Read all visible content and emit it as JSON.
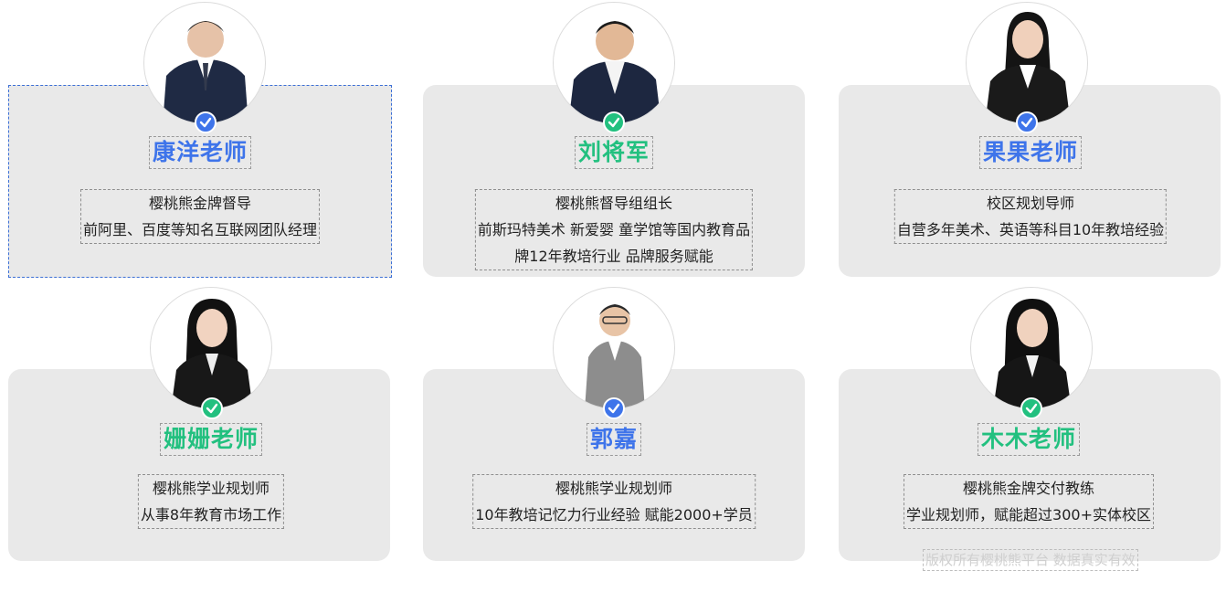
{
  "colors": {
    "blue_accent": "#3e74ea",
    "green_accent": "#22c07f",
    "card_bg": "#e9e9e9",
    "copyright_text": "#cfcfcf"
  },
  "teachers": [
    {
      "name": "康洋老师",
      "accent": "blue",
      "lines": [
        "樱桃熊金牌督导",
        "前阿里、百度等知名互联网团队经理"
      ],
      "icon": "check-badge-icon"
    },
    {
      "name": "刘将军",
      "accent": "green",
      "lines": [
        "樱桃熊督导组组长",
        "前斯玛特美术 新爱婴 童学馆等国内教育品",
        "牌12年教培行业 品牌服务赋能"
      ],
      "icon": "check-badge-icon"
    },
    {
      "name": "果果老师",
      "accent": "blue",
      "lines": [
        "校区规划导师",
        "自营多年美术、英语等科目10年教培经验"
      ],
      "icon": "check-badge-icon"
    },
    {
      "name": "姗姗老师",
      "accent": "green",
      "lines": [
        "樱桃熊学业规划师",
        "从事8年教育市场工作"
      ],
      "icon": "check-badge-icon"
    },
    {
      "name": "郭嘉",
      "accent": "blue",
      "lines": [
        "樱桃熊学业规划师",
        "10年教培记忆力行业经验 赋能2000+学员"
      ],
      "icon": "check-badge-icon"
    },
    {
      "name": "木木老师",
      "accent": "green",
      "lines": [
        "樱桃熊金牌交付教练",
        "学业规划师，赋能超过300+实体校区"
      ],
      "icon": "check-badge-icon"
    }
  ],
  "footer": {
    "copyright": "版权所有樱桃熊平台 数据真实有效"
  }
}
